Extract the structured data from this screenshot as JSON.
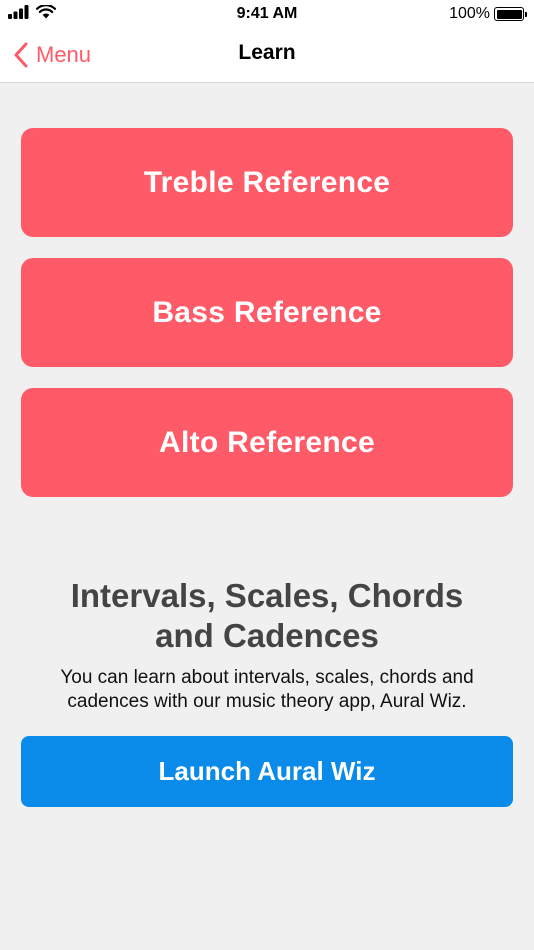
{
  "status_bar": {
    "time": "9:41 AM",
    "battery": "100%",
    "icons": [
      "signal-bars-icon",
      "wifi-icon",
      "battery-icon"
    ]
  },
  "nav": {
    "back_label": "Menu",
    "title": "Learn"
  },
  "references": [
    {
      "label": "Treble Reference"
    },
    {
      "label": "Bass Reference"
    },
    {
      "label": "Alto Reference"
    }
  ],
  "promo": {
    "heading": "Intervals, Scales, Chords and Cadences",
    "description": "You can learn about intervals, scales, chords and cadences with our music theory app, Aural Wiz.",
    "button_label": "Launch Aural Wiz"
  },
  "colors": {
    "accent_red": "#ff5a67",
    "accent_blue": "#0a8be9",
    "background": "#f0f0f0"
  }
}
